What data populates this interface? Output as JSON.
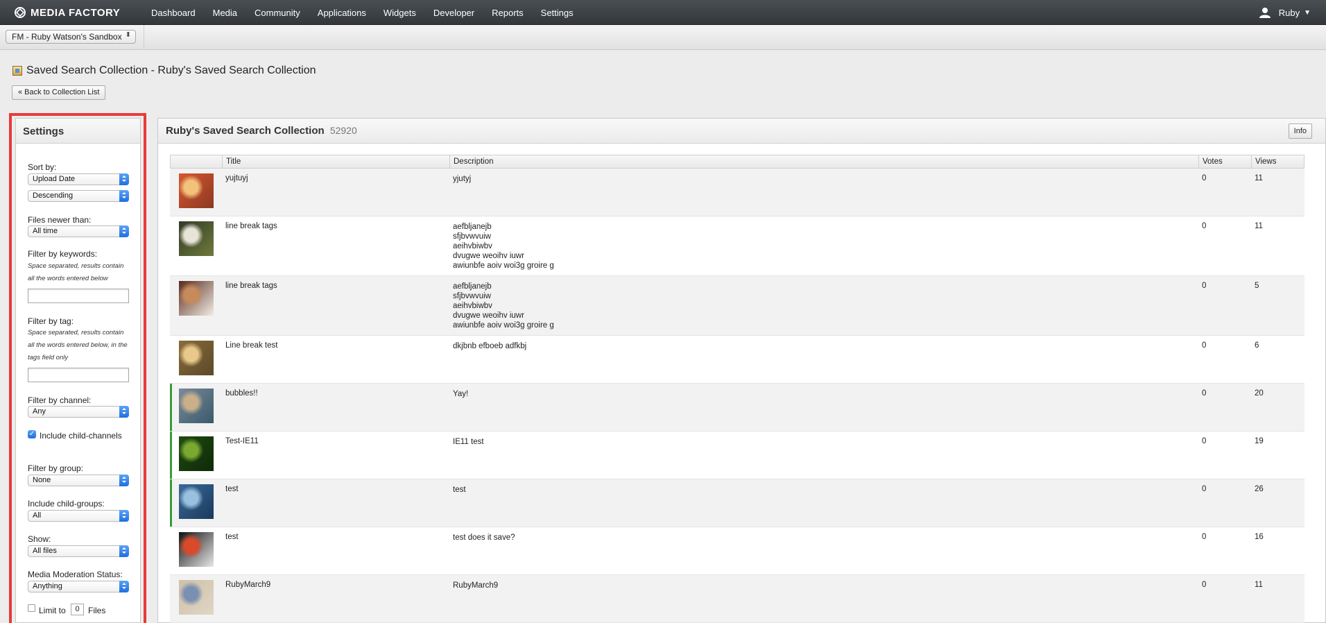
{
  "app": {
    "brand": "MEDIA FACTORY",
    "nav": [
      "Dashboard",
      "Media",
      "Community",
      "Applications",
      "Widgets",
      "Developer",
      "Reports",
      "Settings"
    ],
    "user": "Ruby"
  },
  "account": {
    "selected": "FM - Ruby Watson's Sandbox"
  },
  "page": {
    "title": "Saved Search Collection - Ruby's Saved Search Collection",
    "back_button": "« Back to Collection List"
  },
  "settings": {
    "heading": "Settings",
    "sort_by_label": "Sort by:",
    "sort_by": "Upload Date",
    "sort_order": "Descending",
    "files_newer_label": "Files newer than:",
    "files_newer": "All time",
    "keywords_label": "Filter by keywords:",
    "keywords_hint": "Space separated, results contain all the words entered below",
    "keywords_value": "",
    "tag_label": "Filter by tag:",
    "tag_hint": "Space separated, results contain all the words entered below, in the tags field only",
    "tag_value": "",
    "channel_label": "Filter by channel:",
    "channel": "Any",
    "include_child_channels_label": "Include child-channels",
    "include_child_channels": true,
    "group_label": "Filter by group:",
    "group": "None",
    "child_groups_label": "Include child-groups:",
    "child_groups": "All",
    "show_label": "Show:",
    "show": "All files",
    "moderation_label": "Media Moderation Status:",
    "moderation": "Anything",
    "limit_prefix": "Limit to",
    "limit_value": "0",
    "limit_suffix": "Files"
  },
  "collection": {
    "name": "Ruby's Saved Search Collection",
    "id": "52920",
    "info_button": "Info",
    "columns": [
      "Title",
      "Description",
      "Votes",
      "Views"
    ],
    "rows": [
      {
        "title": "yujtuyj",
        "description": "yjutyj",
        "votes": "0",
        "views": "11",
        "thumb_colors": [
          "#d9552f",
          "#f3c27a",
          "#8a3a22"
        ]
      },
      {
        "title": "line break tags",
        "description": "aefbljanejb\nsfjbvwvuiw\naeihvbiwbv\ndvugwe weoihv iuwr\nawiunbfe aoiv woi3g groire g",
        "votes": "0",
        "views": "11",
        "thumb_colors": [
          "#2f3a26",
          "#e9e4d8",
          "#6f7a3c"
        ]
      },
      {
        "title": "line break tags",
        "description": "aefbljanejb\nsfjbvwvuiw\naeihvbiwbv\ndvugwe weoihv iuwr\nawiunbfe aoiv woi3g groire g",
        "votes": "0",
        "views": "5",
        "thumb_colors": [
          "#5a2a1a",
          "#c78a5a",
          "#f1ede6"
        ]
      },
      {
        "title": "Line break test",
        "description": "dkjbnb efboeb adfkbj",
        "votes": "0",
        "views": "6",
        "thumb_colors": [
          "#8a6a3a",
          "#e8c98a",
          "#5a4a2a"
        ]
      },
      {
        "title": "bubbles!!",
        "description": "Yay!",
        "votes": "0",
        "views": "20",
        "thumb_colors": [
          "#7a8a9a",
          "#c9b08a",
          "#3a5a6a"
        ]
      },
      {
        "title": "Test-IE11",
        "description": "IE11 test",
        "votes": "0",
        "views": "19",
        "thumb_colors": [
          "#1f4a12",
          "#7aa830",
          "#0f2a08"
        ]
      },
      {
        "title": "test",
        "description": "test",
        "votes": "0",
        "views": "26",
        "thumb_colors": [
          "#3a6a9a",
          "#9ac0e0",
          "#1a3a5a"
        ]
      },
      {
        "title": "test",
        "description": "test does it save?",
        "votes": "0",
        "views": "16",
        "thumb_colors": [
          "#111111",
          "#d84a2a",
          "#e8e8e8"
        ]
      },
      {
        "title": "RubyMarch9",
        "description": "RubyMarch9",
        "votes": "0",
        "views": "11",
        "thumb_colors": [
          "#cfc0a8",
          "#7a90b0",
          "#e0d6c6"
        ]
      }
    ]
  },
  "colors": {
    "topbar": "#3d4246",
    "highlight_outline": "#e83a3a",
    "select_accent": "#2f7de8",
    "row_marker": "#3a9a3a"
  }
}
